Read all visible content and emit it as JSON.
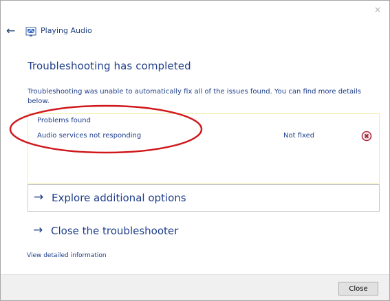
{
  "window": {
    "title": "Playing Audio",
    "close_glyph": "×",
    "back_glyph": "←"
  },
  "main": {
    "heading": "Troubleshooting has completed",
    "description": "Troubleshooting was unable to automatically fix all of the issues found. You can find more details below.",
    "problems": {
      "header": "Problems found",
      "items": [
        {
          "name": "Audio services not responding",
          "status": "Not fixed",
          "status_icon": "not-fixed-icon"
        }
      ]
    },
    "options": [
      {
        "label": "Explore additional options",
        "arrow": "→"
      },
      {
        "label": "Close the troubleshooter",
        "arrow": "→"
      }
    ],
    "detail_link": "View detailed information"
  },
  "footer": {
    "close_label": "Close"
  },
  "colors": {
    "text_blue": "#1e3d8a",
    "annotation_red": "#d0181c",
    "problems_border": "#f0eba8"
  }
}
